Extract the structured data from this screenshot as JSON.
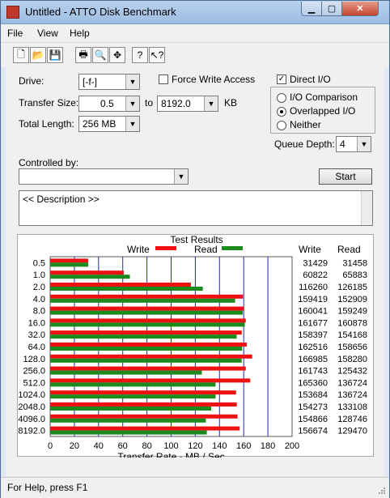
{
  "window": {
    "title": "Untitled - ATTO Disk Benchmark",
    "close_label": "✕",
    "min_label": "▁",
    "max_label": "▢"
  },
  "menu": [
    "File",
    "View",
    "Help"
  ],
  "toolbar": {
    "icons": [
      "new-icon",
      "open-icon",
      "save-icon",
      "print-icon",
      "print-preview-icon",
      "move-icon",
      "help-icon",
      "context-help-icon"
    ],
    "glyphs": [
      "🗋",
      "📂",
      "💾",
      "🖶",
      "🔍",
      "✥",
      "?",
      "↖?"
    ]
  },
  "form": {
    "drive_label": "Drive:",
    "drive_value": "[-f-]",
    "force_write_label": "Force Write Access",
    "direct_io_label": "Direct I/O",
    "transfer_size_label": "Transfer Size:",
    "transfer_from": "0.5",
    "to_label": "to",
    "transfer_to": "8192.0",
    "kb_label": "KB",
    "total_length_label": "Total Length:",
    "total_length_value": "256 MB",
    "io_comparison_label": "I/O Comparison",
    "overlapped_io_label": "Overlapped I/O",
    "neither_label": "Neither",
    "queue_depth_label": "Queue Depth:",
    "queue_depth_value": "4",
    "controlled_by_label": "Controlled by:",
    "controlled_by_value": "",
    "start_label": "Start",
    "description_text": "<< Description >>"
  },
  "results": {
    "title": "Test Results",
    "write_legend": "Write",
    "read_legend": "Read",
    "write_col": "Write",
    "read_col": "Read",
    "rows": [
      {
        "size": "0.5",
        "write": "31429",
        "read": "31458"
      },
      {
        "size": "1.0",
        "write": "60822",
        "read": "65883"
      },
      {
        "size": "2.0",
        "write": "116260",
        "read": "126185"
      },
      {
        "size": "4.0",
        "write": "159419",
        "read": "152909"
      },
      {
        "size": "8.0",
        "write": "160041",
        "read": "159249"
      },
      {
        "size": "16.0",
        "write": "161677",
        "read": "160878"
      },
      {
        "size": "32.0",
        "write": "158397",
        "read": "154168"
      },
      {
        "size": "64.0",
        "write": "162516",
        "read": "158656"
      },
      {
        "size": "128.0",
        "write": "166985",
        "read": "158280"
      },
      {
        "size": "256.0",
        "write": "161743",
        "read": "125432"
      },
      {
        "size": "512.0",
        "write": "165360",
        "read": "136724"
      },
      {
        "size": "1024.0",
        "write": "153684",
        "read": "136724"
      },
      {
        "size": "2048.0",
        "write": "154273",
        "read": "133108"
      },
      {
        "size": "4096.0",
        "write": "154866",
        "read": "128746"
      },
      {
        "size": "8192.0",
        "write": "156674",
        "read": "129470"
      }
    ]
  },
  "chart_data": {
    "type": "bar",
    "orientation": "horizontal",
    "title": "Test Results",
    "xlabel": "Transfer Rate - MB / Sec",
    "ylabel": "",
    "xlim": [
      0,
      200
    ],
    "xticks": [
      "0",
      "20",
      "40",
      "60",
      "80",
      "100",
      "120",
      "140",
      "160",
      "180",
      "200"
    ],
    "categories": [
      "0.5",
      "1.0",
      "2.0",
      "4.0",
      "8.0",
      "16.0",
      "32.0",
      "64.0",
      "128.0",
      "256.0",
      "512.0",
      "1024.0",
      "2048.0",
      "4096.0",
      "8192.0"
    ],
    "series": [
      {
        "name": "Write",
        "color": "#ee1111",
        "values": [
          31.4,
          60.8,
          116.3,
          159.4,
          160.0,
          161.7,
          158.4,
          162.5,
          167.0,
          161.7,
          165.4,
          153.7,
          154.3,
          154.9,
          156.7
        ]
      },
      {
        "name": "Read",
        "color": "#1c8a1c",
        "values": [
          31.5,
          65.9,
          126.2,
          152.9,
          159.2,
          160.9,
          154.2,
          158.7,
          158.3,
          125.4,
          136.7,
          136.7,
          133.1,
          128.7,
          129.5
        ]
      }
    ],
    "grid": true,
    "legend": "top"
  },
  "status": {
    "text": "For Help, press F1"
  }
}
